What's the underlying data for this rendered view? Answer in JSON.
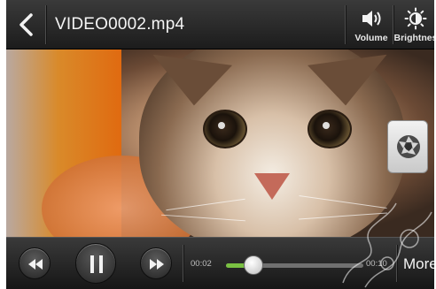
{
  "header": {
    "title": "VIDEO0002.mp4",
    "volume_label": "Volume",
    "brightness_label": "Brightnes"
  },
  "player": {
    "elapsed": "00:02",
    "duration": "00:10",
    "progress_fraction": 0.2,
    "more_label": "More"
  },
  "icons": {
    "back": "chevron-left-icon",
    "volume": "speaker-icon",
    "brightness": "sun-icon",
    "rewind": "rewind-icon",
    "pause": "pause-icon",
    "forward": "fast-forward-icon",
    "shutter": "camera-shutter-icon"
  },
  "colors": {
    "progress_fill": "#7ac142"
  }
}
